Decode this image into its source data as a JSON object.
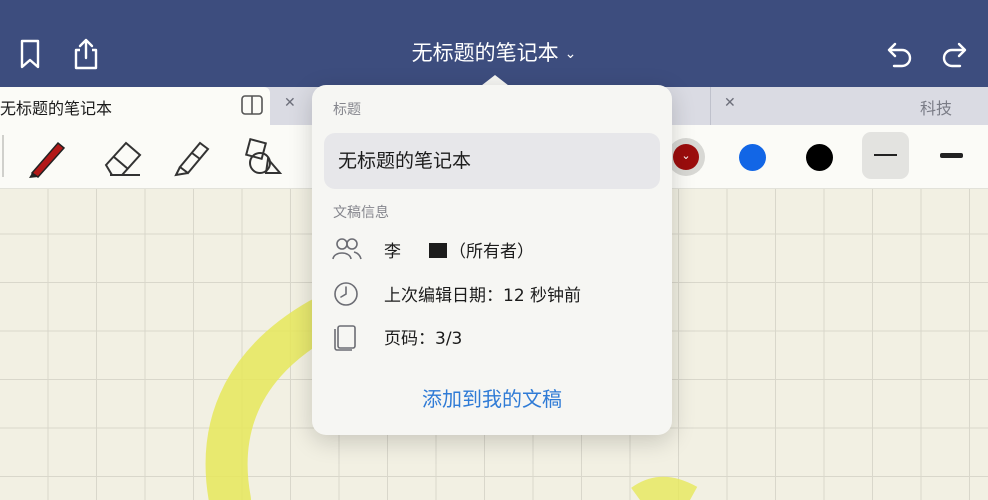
{
  "header": {
    "title": "无标题的笔记本",
    "icons": [
      "bookmark-icon",
      "share-icon",
      "chevron-down-icon",
      "undo-icon",
      "redo-icon"
    ],
    "background_color": "#3d4d7e"
  },
  "tabs": [
    {
      "label": "无标题的笔记本",
      "active": true
    },
    {
      "label": "",
      "active": false
    },
    {
      "label": "科技",
      "active": false
    }
  ],
  "toolbar": {
    "tools": [
      "pen-icon",
      "eraser-icon",
      "highlighter-icon",
      "shapes-icon"
    ],
    "colors": [
      "#9b0d0d",
      "#1266e6",
      "#000000"
    ],
    "line_widths": [
      "thin",
      "thick"
    ]
  },
  "popover": {
    "title_section_label": "标题",
    "title_value": "无标题的笔记本",
    "info_section_label": "文稿信息",
    "owner_prefix": "李",
    "owner_suffix": "（所有者）",
    "last_edited": "上次编辑日期：12 秒钟前",
    "pages": "页码：3/3",
    "add_button_label": "添加到我的文稿"
  }
}
